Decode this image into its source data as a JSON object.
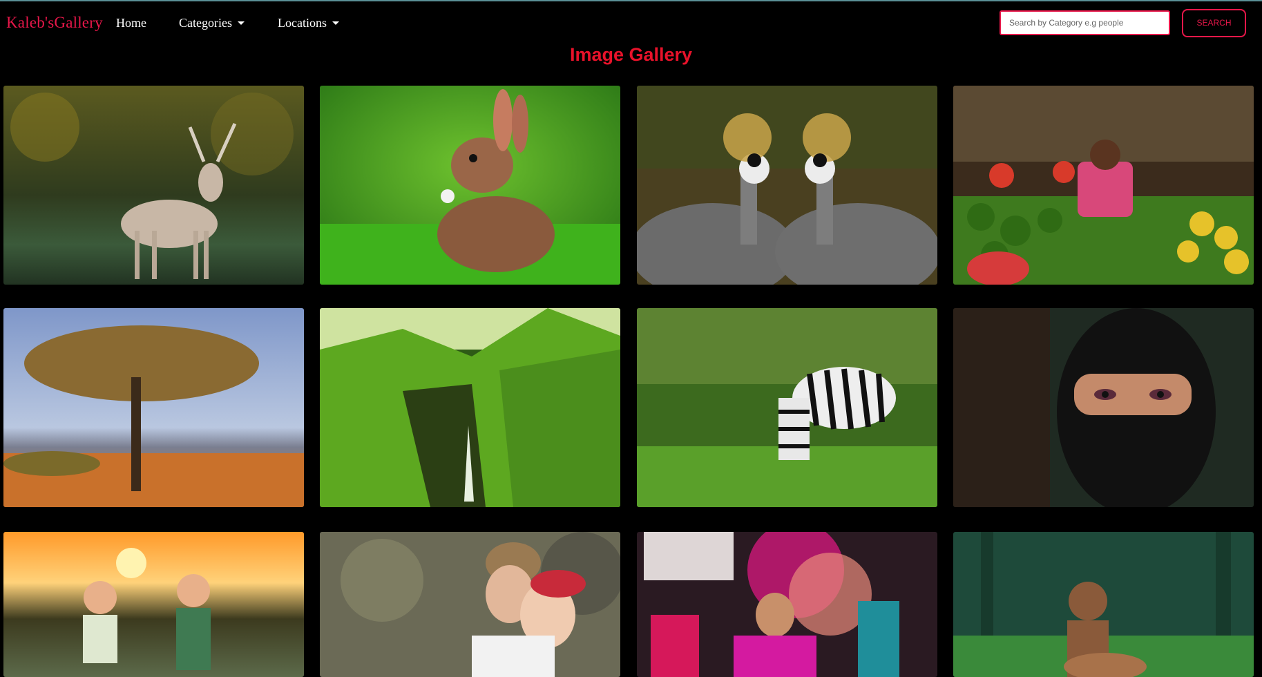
{
  "navbar": {
    "brand": "Kaleb'sGallery",
    "links": [
      {
        "label": "Home"
      },
      {
        "label": "Categories",
        "dropdown": true
      },
      {
        "label": "Locations",
        "dropdown": true
      }
    ],
    "search": {
      "placeholder": "Search by Category e.g people",
      "value": "",
      "button_label": "SEARCH"
    }
  },
  "main": {
    "title": "Image Gallery",
    "images": [
      {
        "subject": "deer"
      },
      {
        "subject": "rabbit"
      },
      {
        "subject": "crowned cranes"
      },
      {
        "subject": "fruit market vendor"
      },
      {
        "subject": "acacia tree"
      },
      {
        "subject": "waterfall valley"
      },
      {
        "subject": "zebra"
      },
      {
        "subject": "woman in hijab"
      },
      {
        "subject": "children at sunset"
      },
      {
        "subject": "couple"
      },
      {
        "subject": "holi festival dancer"
      },
      {
        "subject": "boy with goat"
      }
    ]
  },
  "colors": {
    "accent": "#e8174a",
    "title": "#e8122a",
    "background": "#000000"
  }
}
